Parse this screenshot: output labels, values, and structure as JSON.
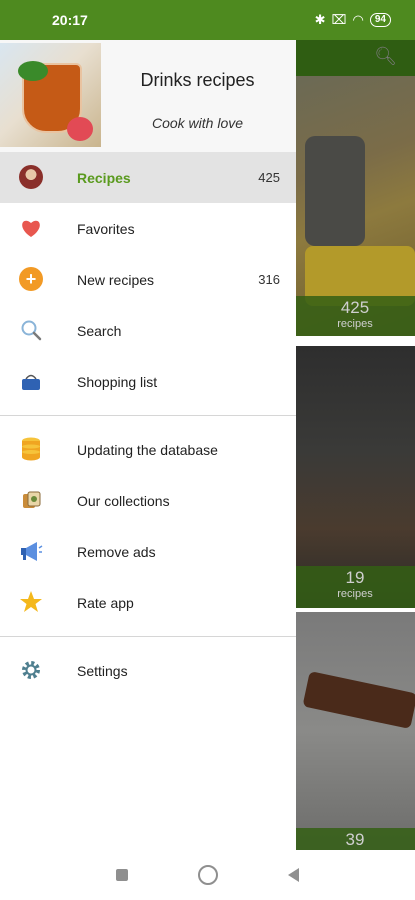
{
  "status_bar": {
    "time": "20:17",
    "battery": "94"
  },
  "header": {
    "title": "Drinks recipes",
    "subtitle": "Cook with love"
  },
  "menu_primary": [
    {
      "label": "Recipes",
      "count": "425",
      "icon": "recipes-avatar-icon",
      "active": true
    },
    {
      "label": "Favorites",
      "count": "",
      "icon": "heart-icon"
    },
    {
      "label": "New recipes",
      "count": "316",
      "icon": "plus-circle-icon"
    },
    {
      "label": "Search",
      "count": "",
      "icon": "search-icon"
    },
    {
      "label": "Shopping list",
      "count": "",
      "icon": "basket-icon"
    }
  ],
  "menu_secondary": [
    {
      "label": "Updating the database",
      "icon": "database-icon"
    },
    {
      "label": "Our collections",
      "icon": "collections-icon"
    },
    {
      "label": "Remove ads",
      "icon": "megaphone-icon"
    },
    {
      "label": "Rate app",
      "icon": "star-icon"
    }
  ],
  "menu_tertiary": [
    {
      "label": "Settings",
      "icon": "gear-icon"
    }
  ],
  "background_cards": [
    {
      "count": "425",
      "unit": "recipes"
    },
    {
      "count": "19",
      "unit": "recipes"
    },
    {
      "count": "39",
      "unit": ""
    }
  ],
  "colors": {
    "accent": "#5a9a1e",
    "status_bar": "#4e8a1f",
    "active_bg": "#e3e3e3"
  }
}
